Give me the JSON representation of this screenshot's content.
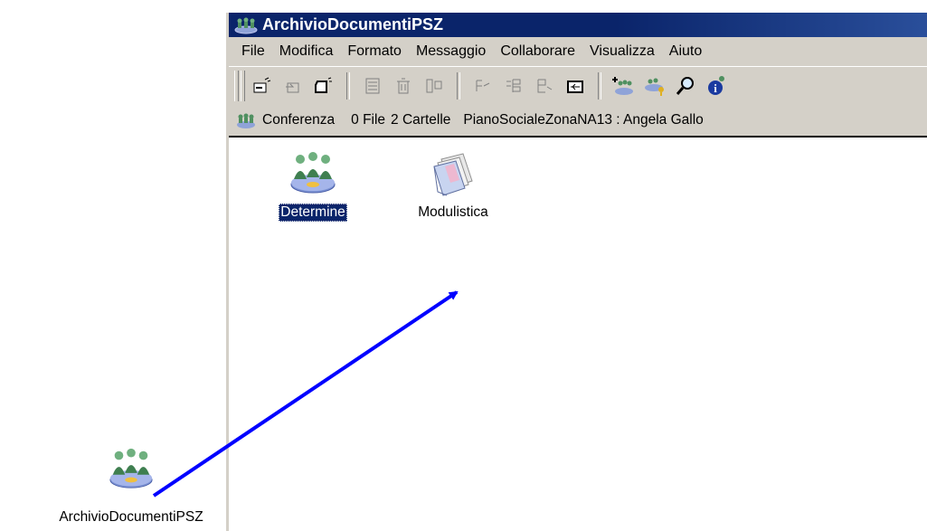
{
  "window": {
    "title": "ArchivioDocumentiPSZ"
  },
  "menu": {
    "items": [
      {
        "label": "File"
      },
      {
        "label": "Modifica"
      },
      {
        "label": "Formato"
      },
      {
        "label": "Messaggio"
      },
      {
        "label": "Collaborare"
      },
      {
        "label": "Visualizza"
      },
      {
        "label": "Aiuto"
      }
    ]
  },
  "toolbar": {
    "icons": [
      "new-doc-icon",
      "reply-icon",
      "new-note-icon",
      "list-icon",
      "delete-icon",
      "properties-icon",
      "forward-icon",
      "tree-icon",
      "move-icon",
      "up-folder-icon",
      "add-member-icon",
      "key-icon",
      "search-icon",
      "info-icon"
    ]
  },
  "status": {
    "type": "Conferenza",
    "files": "0 File",
    "folders": "2 Cartelle",
    "path": "PianoSocialeZonaNA13 : Angela Gallo"
  },
  "content": {
    "items": [
      {
        "label": "Determine",
        "icon": "conference-icon",
        "selected": true
      },
      {
        "label": "Modulistica",
        "icon": "documents-icon",
        "selected": false
      }
    ]
  },
  "desktop": {
    "icon_label": "ArchivioDocumentiPSZ"
  },
  "colors": {
    "titlebar": "#0a246a",
    "chrome": "#d4d0c8",
    "selection": "#0a246a",
    "annotation_arrow": "#0000ff"
  }
}
